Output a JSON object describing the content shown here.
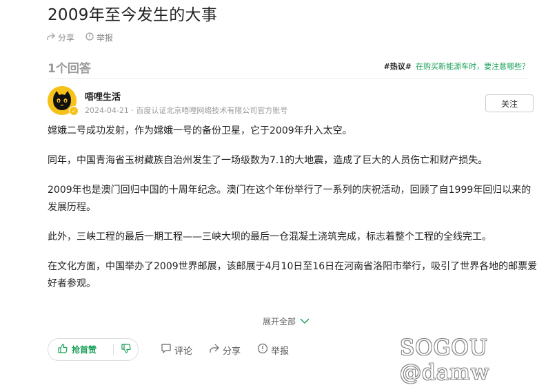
{
  "question": {
    "title": "2009年至今发生的大事",
    "share_label": "分享",
    "report_label": "举报"
  },
  "answers": {
    "count_label": "1个回答"
  },
  "hot_topic": {
    "tag": "#热议#",
    "text": "在购买新能源车时，要注意哪些？"
  },
  "answer": {
    "author_name": "唔哩生活",
    "meta": "2024-04-21 · 百度认证北京唔哩网络技术有限公司官方账号",
    "follow_label": "关注",
    "paragraphs": [
      "嫦娥二号成功发射，作为嫦娥一号的备份卫星，它于2009年升入太空。",
      "同年，中国青海省玉树藏族自治州发生了一场级数为7.1的大地震，造成了巨大的人员伤亡和财产损失。",
      "2009年也是澳门回归中国的十周年纪念。澳门在这个年份举行了一系列的庆祝活动，回顾了自1999年回归以来的发展历程。",
      "此外，三峡工程的最后一期工程——三峡大坝的最后一仓混凝土浇筑完成，标志着整个工程的全线完工。",
      "在文化方面，中国举办了2009世界邮展，该邮展于4月10日至16日在河南省洛阳市举行，吸引了世界各地的邮票爱好者参观。"
    ],
    "expand_label": "展开全部",
    "vote_up_label": "抢首赞",
    "comment_label": "评论",
    "share_label": "分享",
    "report_label": "举报"
  },
  "watermark": "SOGOU @damw",
  "colors": {
    "accent": "#18a058",
    "avatar_bg": "#f6c21a"
  },
  "icons": [
    "share-icon",
    "report-icon",
    "chevron-down-icon",
    "thumbs-up-icon",
    "thumbs-down-icon",
    "comment-icon"
  ]
}
